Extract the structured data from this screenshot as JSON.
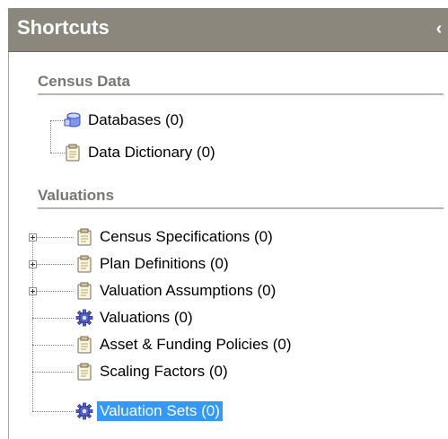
{
  "header": {
    "title": "Shortcuts",
    "collapse_glyph": "‹"
  },
  "sections": [
    {
      "title": "Census Data",
      "items": [
        {
          "label": "Databases (0)",
          "icon": "database-icon"
        },
        {
          "label": "Data Dictionary (0)",
          "icon": "clipboard-icon"
        }
      ]
    },
    {
      "title": "Valuations",
      "items": [
        {
          "label": "Census Specifications (0)",
          "icon": "clipboard-icon",
          "expandable": true
        },
        {
          "label": "Plan Definitions (0)",
          "icon": "clipboard-icon",
          "expandable": true
        },
        {
          "label": "Valuation Assumptions (0)",
          "icon": "clipboard-icon",
          "expandable": true
        },
        {
          "label": "Valuations (0)",
          "icon": "gear-icon"
        },
        {
          "label": "Asset & Funding Policies (0)",
          "icon": "clipboard-icon"
        },
        {
          "label": "Scaling Factors (0)",
          "icon": "clipboard-icon"
        },
        {
          "label": "Valuation Sets (0)",
          "icon": "gear-icon",
          "selected": true
        }
      ]
    }
  ],
  "colors": {
    "header_bg": "#8c877d",
    "selection": "#3399ff",
    "section_text": "#7a7670"
  }
}
